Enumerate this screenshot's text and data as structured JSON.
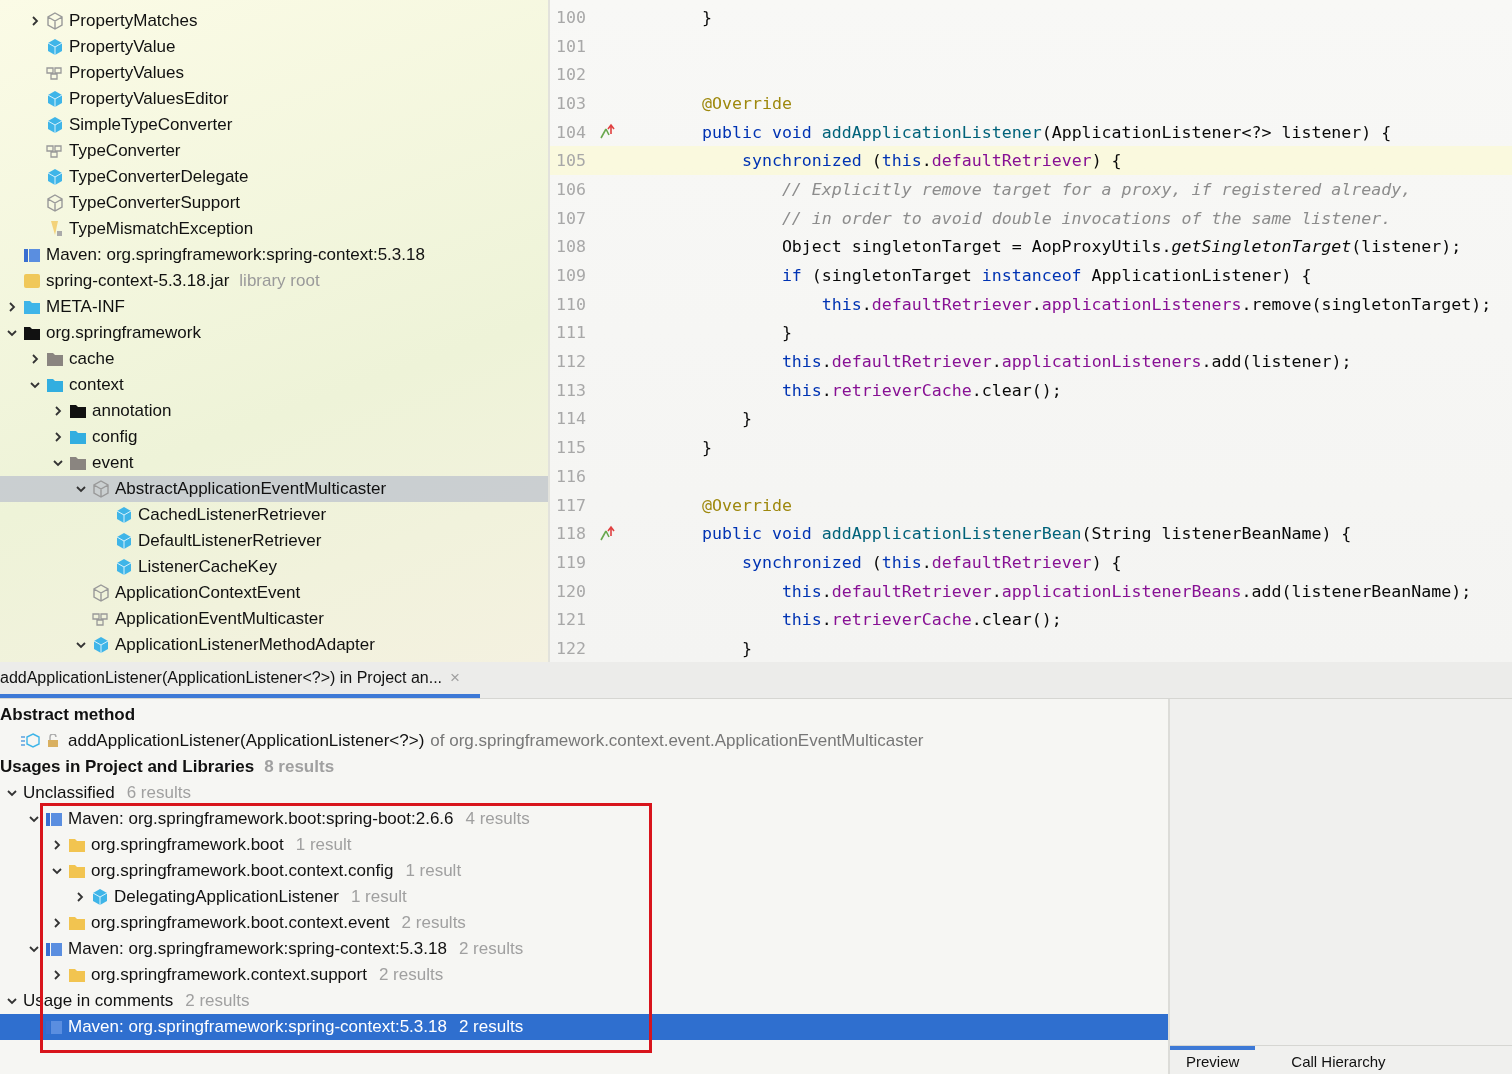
{
  "project_tree": {
    "partial_items": [
      {
        "label": "PropertyMatches",
        "kind": "abstract",
        "expanded": false,
        "selected": false
      },
      {
        "label": "PropertyValue",
        "kind": "class",
        "selected": false
      },
      {
        "label": "PropertyValues",
        "kind": "interface",
        "selected": false
      },
      {
        "label": "PropertyValuesEditor",
        "kind": "class",
        "selected": false
      },
      {
        "label": "SimpleTypeConverter",
        "kind": "class",
        "selected": false
      },
      {
        "label": "TypeConverter",
        "kind": "interface",
        "selected": false
      },
      {
        "label": "TypeConverterDelegate",
        "kind": "class",
        "selected": false
      },
      {
        "label": "TypeConverterSupport",
        "kind": "abstract",
        "selected": false
      },
      {
        "label": "TypeMismatchException",
        "kind": "exception",
        "selected": false
      }
    ],
    "library": {
      "label": "Maven: org.springframework:spring-context:5.3.18",
      "kind": "library",
      "selected": false,
      "children": [
        {
          "label": "spring-context-5.3.18.jar",
          "note": "library root",
          "kind": "jar",
          "selected": false,
          "children": [
            {
              "label": "META-INF",
              "kind": "resource",
              "expanded": false,
              "selected": false
            },
            {
              "label": "org.springframework",
              "kind": "package",
              "expanded": true,
              "selected": false,
              "children": [
                {
                  "label": "cache",
                  "kind": "package-grey",
                  "expanded": false,
                  "selected": false
                },
                {
                  "label": "context",
                  "kind": "package-blue",
                  "expanded": true,
                  "selected": false,
                  "children": [
                    {
                      "label": "annotation",
                      "kind": "package",
                      "expanded": false,
                      "selected": false
                    },
                    {
                      "label": "config",
                      "kind": "package-blue",
                      "expanded": false,
                      "selected": false
                    },
                    {
                      "label": "event",
                      "kind": "package-grey",
                      "expanded": true,
                      "selected": false,
                      "children": [
                        {
                          "label": "AbstractApplicationEventMulticaster",
                          "kind": "abstract",
                          "expanded": true,
                          "selected": true,
                          "children": [
                            {
                              "label": "CachedListenerRetriever",
                              "kind": "class",
                              "selected": false
                            },
                            {
                              "label": "DefaultListenerRetriever",
                              "kind": "class",
                              "selected": false
                            },
                            {
                              "label": "ListenerCacheKey",
                              "kind": "class",
                              "selected": false
                            }
                          ]
                        },
                        {
                          "label": "ApplicationContextEvent",
                          "kind": "abstract",
                          "selected": false
                        },
                        {
                          "label": "ApplicationEventMulticaster",
                          "kind": "interface",
                          "selected": false
                        },
                        {
                          "label": "ApplicationListenerMethodAdapter",
                          "kind": "class",
                          "expanded": true,
                          "selected": false
                        }
                      ]
                    }
                  ]
                }
              ]
            }
          ]
        }
      ]
    }
  },
  "editor": {
    "lines": [
      {
        "number": "100",
        "current": false,
        "implemented": false,
        "tokens": [
          {
            "text": "    }",
            "kind": "plain"
          }
        ]
      },
      {
        "number": "101",
        "current": false,
        "implemented": false
      },
      {
        "number": "102",
        "current": false,
        "implemented": false
      },
      {
        "number": "103",
        "current": false,
        "implemented": false,
        "tokens": [
          {
            "text": "    @Override",
            "kind": "ann"
          }
        ]
      },
      {
        "number": "104",
        "current": false,
        "implemented": true,
        "tokens": [
          {
            "text": "    public void ",
            "kind": "kw"
          },
          {
            "text": "addApplicationListener",
            "kind": "decl"
          },
          {
            "text": "(ApplicationListener<?> listener) {",
            "kind": "plain"
          }
        ]
      },
      {
        "number": "105",
        "current": true,
        "implemented": false,
        "tokens": [
          {
            "text": "        synchronized ",
            "kind": "kw"
          },
          {
            "text": "(",
            "kind": "plain"
          },
          {
            "text": "this",
            "kind": "kw"
          },
          {
            "text": ".",
            "kind": "plain"
          },
          {
            "text": "defaultRetriever",
            "kind": "field"
          },
          {
            "text": ") {",
            "kind": "plain"
          }
        ]
      },
      {
        "number": "106",
        "current": false,
        "implemented": false,
        "tokens": [
          {
            "text": "            // Explicitly remove target for a proxy, if registered already,",
            "kind": "comment"
          }
        ]
      },
      {
        "number": "107",
        "current": false,
        "implemented": false,
        "tokens": [
          {
            "text": "            // in order to avoid double invocations of the same listener.",
            "kind": "comment"
          }
        ]
      },
      {
        "number": "108",
        "current": false,
        "implemented": false,
        "tokens": [
          {
            "text": "            Object singletonTarget = AopProxyUtils.",
            "kind": "plain"
          },
          {
            "text": "getSingletonTarget",
            "kind": "static"
          },
          {
            "text": "(listener);",
            "kind": "plain"
          }
        ]
      },
      {
        "number": "109",
        "current": false,
        "implemented": false,
        "tokens": [
          {
            "text": "            if ",
            "kind": "kw"
          },
          {
            "text": "(singletonTarget ",
            "kind": "plain"
          },
          {
            "text": "instanceof ",
            "kind": "kw"
          },
          {
            "text": "ApplicationListener) {",
            "kind": "plain"
          }
        ]
      },
      {
        "number": "110",
        "current": false,
        "implemented": false,
        "tokens": [
          {
            "text": "                this",
            "kind": "kw"
          },
          {
            "text": ".",
            "kind": "plain"
          },
          {
            "text": "defaultRetriever",
            "kind": "field"
          },
          {
            "text": ".",
            "kind": "plain"
          },
          {
            "text": "applicationListeners",
            "kind": "field"
          },
          {
            "text": ".remove(singletonTarget);",
            "kind": "plain"
          }
        ]
      },
      {
        "number": "111",
        "current": false,
        "implemented": false,
        "tokens": [
          {
            "text": "            }",
            "kind": "plain"
          }
        ]
      },
      {
        "number": "112",
        "current": false,
        "implemented": false,
        "tokens": [
          {
            "text": "            this",
            "kind": "kw"
          },
          {
            "text": ".",
            "kind": "plain"
          },
          {
            "text": "defaultRetriever",
            "kind": "field"
          },
          {
            "text": ".",
            "kind": "plain"
          },
          {
            "text": "applicationListeners",
            "kind": "field"
          },
          {
            "text": ".add(listener);",
            "kind": "plain"
          }
        ]
      },
      {
        "number": "113",
        "current": false,
        "implemented": false,
        "tokens": [
          {
            "text": "            this",
            "kind": "kw"
          },
          {
            "text": ".",
            "kind": "plain"
          },
          {
            "text": "retrieverCache",
            "kind": "field"
          },
          {
            "text": ".clear();",
            "kind": "plain"
          }
        ]
      },
      {
        "number": "114",
        "current": false,
        "implemented": false,
        "tokens": [
          {
            "text": "        }",
            "kind": "plain"
          }
        ]
      },
      {
        "number": "115",
        "current": false,
        "implemented": false,
        "tokens": [
          {
            "text": "    }",
            "kind": "plain"
          }
        ]
      },
      {
        "number": "116",
        "current": false,
        "implemented": false
      },
      {
        "number": "117",
        "current": false,
        "implemented": false,
        "tokens": [
          {
            "text": "    @Override",
            "kind": "ann"
          }
        ]
      },
      {
        "number": "118",
        "current": false,
        "implemented": true,
        "tokens": [
          {
            "text": "    public void ",
            "kind": "kw"
          },
          {
            "text": "addApplicationListenerBean",
            "kind": "decl"
          },
          {
            "text": "(String listenerBeanName) {",
            "kind": "plain"
          }
        ]
      },
      {
        "number": "119",
        "current": false,
        "implemented": false,
        "tokens": [
          {
            "text": "        synchronized ",
            "kind": "kw"
          },
          {
            "text": "(",
            "kind": "plain"
          },
          {
            "text": "this",
            "kind": "kw"
          },
          {
            "text": ".",
            "kind": "plain"
          },
          {
            "text": "defaultRetriever",
            "kind": "field"
          },
          {
            "text": ") {",
            "kind": "plain"
          }
        ]
      },
      {
        "number": "120",
        "current": false,
        "implemented": false,
        "tokens": [
          {
            "text": "            this",
            "kind": "kw"
          },
          {
            "text": ".",
            "kind": "plain"
          },
          {
            "text": "defaultRetriever",
            "kind": "field"
          },
          {
            "text": ".",
            "kind": "plain"
          },
          {
            "text": "applicationListenerBeans",
            "kind": "field"
          },
          {
            "text": ".add(listenerBeanName);",
            "kind": "plain"
          }
        ]
      },
      {
        "number": "121",
        "current": false,
        "implemented": false,
        "tokens": [
          {
            "text": "            this",
            "kind": "kw"
          },
          {
            "text": ".",
            "kind": "plain"
          },
          {
            "text": "retrieverCache",
            "kind": "field"
          },
          {
            "text": ".clear();",
            "kind": "plain"
          }
        ]
      },
      {
        "number": "122",
        "current": false,
        "implemented": false,
        "tokens": [
          {
            "text": "        }",
            "kind": "plain"
          }
        ]
      }
    ]
  },
  "find_panel": {
    "tabs": [
      {
        "label": "addApplicationListener(ApplicationListener<?>) in Project an...",
        "close": "×",
        "selected": true
      }
    ],
    "target_heading": "Abstract method",
    "target": {
      "name": "addApplicationListener(ApplicationListener<?>)",
      "detail": "of org.springframework.context.event.ApplicationEventMulticaster"
    },
    "usages_heading": "Usages in Project and Libraries",
    "usages_count": "8 results",
    "tree": [
      {
        "label": "Unclassified",
        "count": "6 results",
        "expanded": true,
        "selected": false,
        "children": [
          {
            "label": "Maven: org.springframework.boot:spring-boot:2.6.6",
            "count": "4 results",
            "kind": "library",
            "expanded": true,
            "selected": false,
            "children": [
              {
                "label": "org.springframework.boot",
                "count": "1 result",
                "kind": "folder",
                "expanded": false,
                "selected": false
              },
              {
                "label": "org.springframework.boot.context.config",
                "count": "1 result",
                "kind": "folder",
                "expanded": true,
                "selected": false,
                "children": [
                  {
                    "label": "DelegatingApplicationListener",
                    "count": "1 result",
                    "kind": "class",
                    "expanded": false,
                    "selected": false
                  }
                ]
              },
              {
                "label": "org.springframework.boot.context.event",
                "count": "2 results",
                "kind": "folder",
                "expanded": false,
                "selected": false
              }
            ]
          },
          {
            "label": "Maven: org.springframework:spring-context:5.3.18",
            "count": "2 results",
            "kind": "library",
            "expanded": true,
            "selected": false,
            "children": [
              {
                "label": "org.springframework.context.support",
                "count": "2 results",
                "kind": "folder",
                "expanded": false,
                "selected": false
              }
            ]
          }
        ]
      },
      {
        "label": "Usage in comments",
        "count": "2 results",
        "expanded": true,
        "selected": false,
        "children": [
          {
            "label": "Maven: org.springframework:spring-context:5.3.18",
            "count": "2 results",
            "kind": "library",
            "selected": true
          }
        ]
      }
    ],
    "preview_tabs": [
      {
        "label": "Preview",
        "selected": true
      },
      {
        "label": "Call Hierarchy",
        "selected": false
      }
    ]
  }
}
